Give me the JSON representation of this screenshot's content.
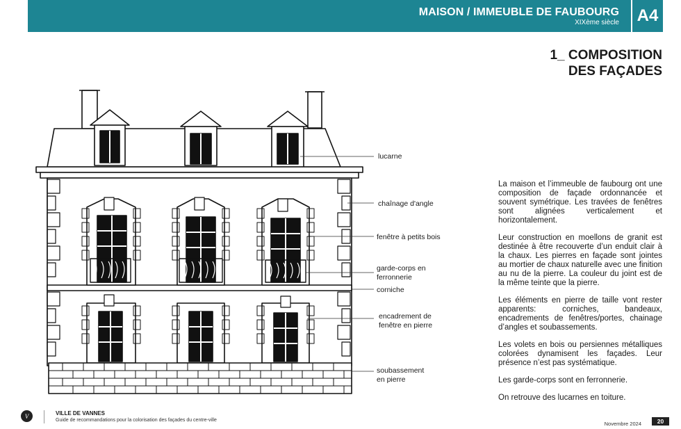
{
  "header": {
    "title": "MAISON / IMMEUBLE DE FAUBOURG",
    "subtitle": "XIXème siècle",
    "code": "A4"
  },
  "section": {
    "title_line1": "1_ COMPOSITION",
    "title_line2": "DES FAÇADES"
  },
  "labels": {
    "lucarne": "lucarne",
    "chainage": "chaînage d'angle",
    "fenetre": "fenêtre à petits bois",
    "garde_corps_1": "garde-corps en",
    "garde_corps_2": "ferronnerie",
    "corniche": "corniche",
    "encadrement_1": "encadrement de",
    "encadrement_2": "fenêtre en pierre",
    "soubassement_1": "soubassement",
    "soubassement_2": "en pierre"
  },
  "body": {
    "p1": "La maison et l’immeuble de faubourg ont une composition de façade ordonnancée et souvent symétrique. Les travées de fenêtres sont alignées verticalement et horizontalement.",
    "p2": "Leur construction en moellons de granit est destinée à être recouverte d’un enduit clair à la chaux. Les pierres en façade sont jointes au mortier de chaux naturelle avec une finition au nu de la pierre. La couleur du joint est de la même teinte que la pierre.",
    "p3": "Les éléments en pierre de taille vont rester apparents: corniches, bandeaux, encadrements de fenêtres/portes, chainage d’angles et soubassements.",
    "p4": "Les volets en bois ou persiennes métalliques colorées dynamisent les façades. Leur présence n’est pas systématique.",
    "p5": "Les garde-corps sont en ferronnerie.",
    "p6": "On retrouve des lucarnes en toiture."
  },
  "footer": {
    "logo_letter": "V",
    "city": "VILLE DE VANNES",
    "guide": "Guide de recommandations pour la colorisation des façades du centre-ville",
    "date": "Novembre 2024",
    "page": "20"
  },
  "colors": {
    "accent": "#1d8593",
    "ink": "#1a1a1a"
  }
}
